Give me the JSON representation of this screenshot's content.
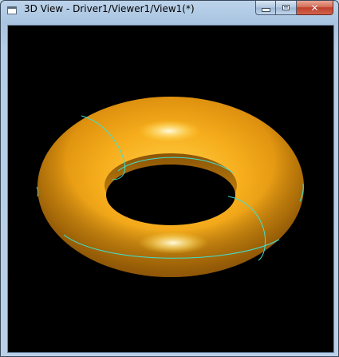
{
  "window": {
    "title": "3D View - Driver1/Viewer1/View1(*)"
  },
  "icons": {
    "app": "app-window-icon",
    "minimize": "minimize-icon",
    "maximize": "maximize-icon",
    "close": "close-icon"
  },
  "colors": {
    "viewport_background": "#000000",
    "torus_surface": "#f2a515",
    "edge_curves": "#40e0d0"
  }
}
